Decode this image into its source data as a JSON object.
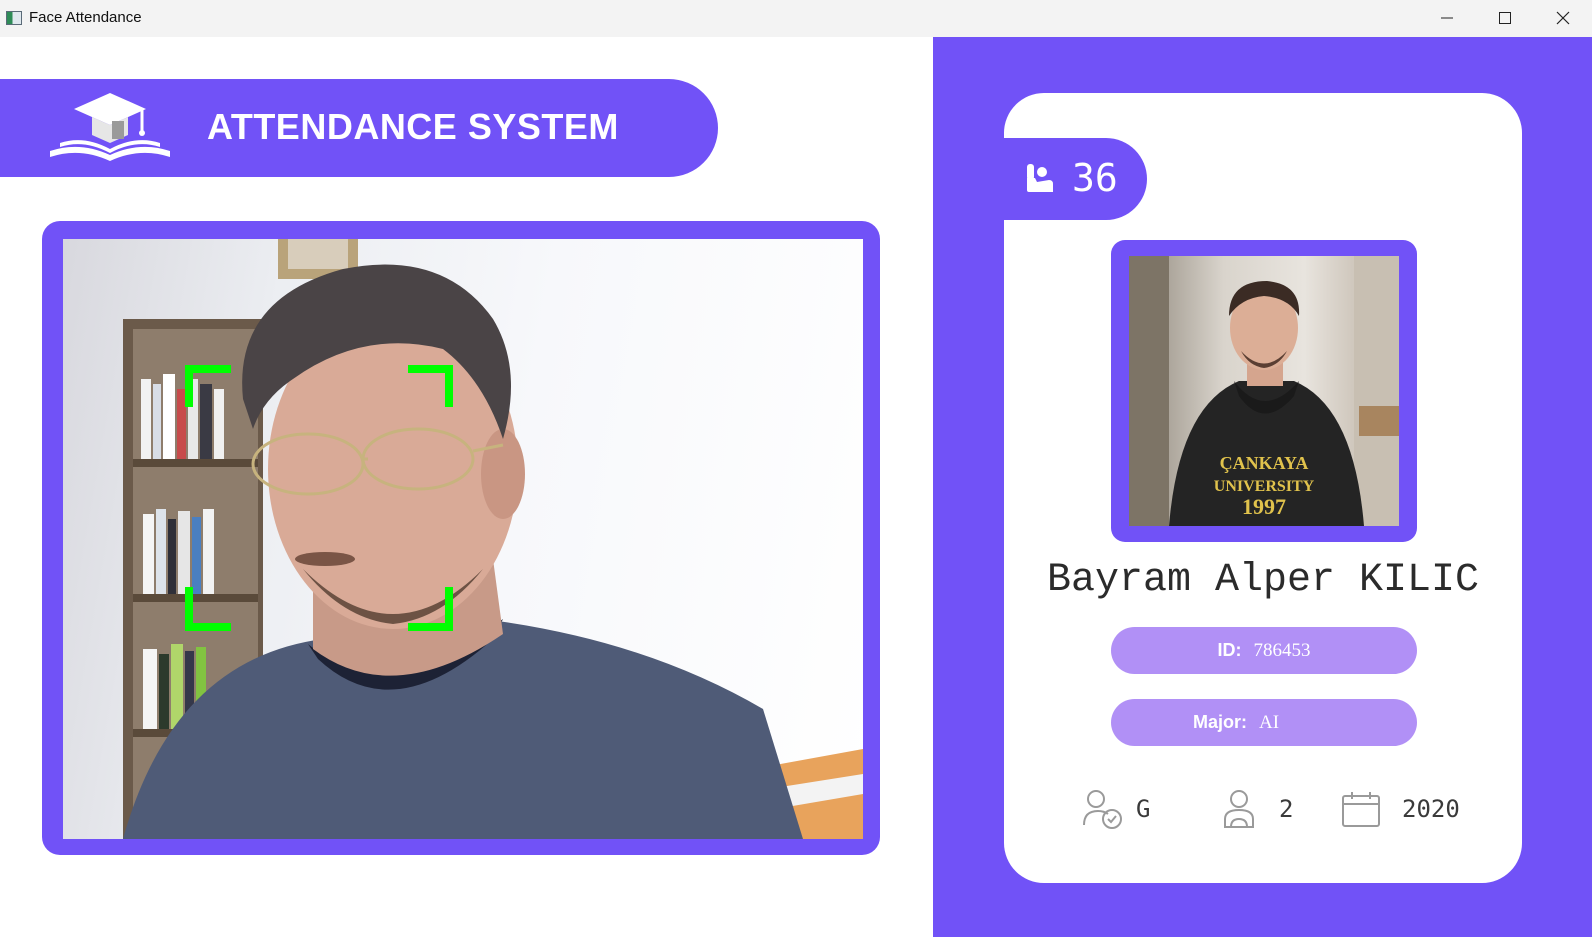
{
  "window": {
    "title": "Face Attendance",
    "controls": [
      "minimize",
      "maximize",
      "close"
    ]
  },
  "header": {
    "title": "ATTENDANCE SYSTEM",
    "logo_icon": "graduation-cap-book-icon"
  },
  "camera": {
    "face_bracket_color": "#00ff00"
  },
  "student": {
    "total_attendance": "36",
    "name": "Bayram Alper KILIC",
    "id_label": "ID:",
    "id_value": "786453",
    "major_label": "Major:",
    "major_value": "AI",
    "standing": "G",
    "year": "2",
    "starting_year": "2020"
  },
  "theme": {
    "accent": "#7152f7",
    "pill": "#b190f6",
    "background": "#ffffff"
  },
  "icons": {
    "attendance": "hand-raise-icon",
    "standing": "user-check-icon",
    "year": "user-icon",
    "starting_year": "calendar-icon"
  }
}
